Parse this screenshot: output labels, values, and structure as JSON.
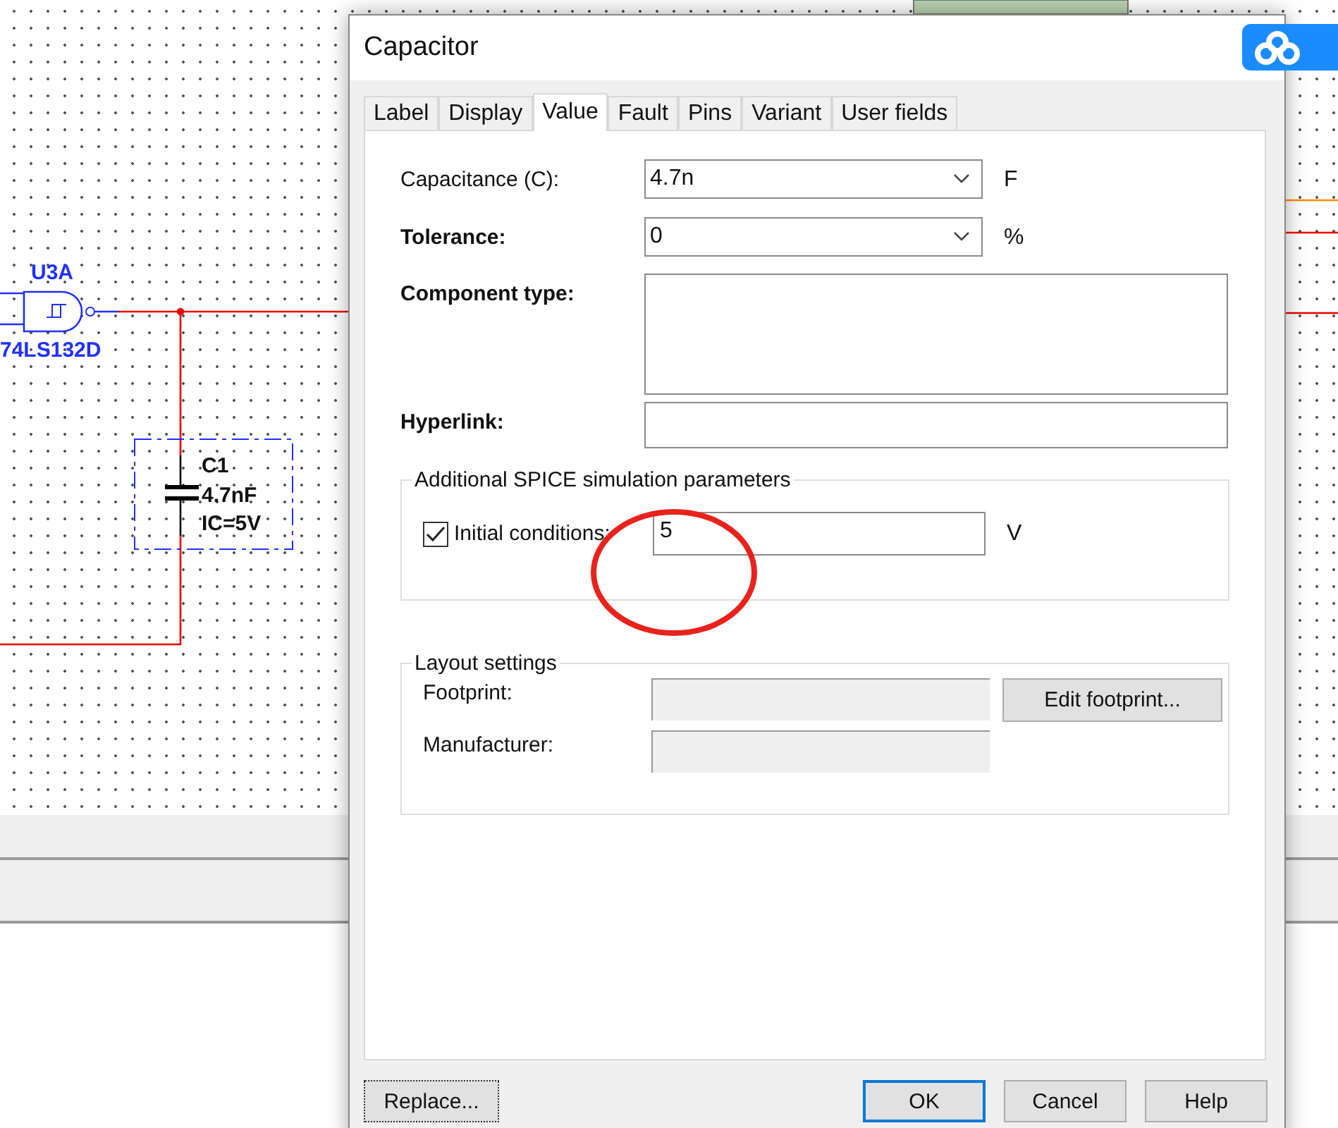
{
  "schematic": {
    "gate": {
      "ref": "U3A",
      "part": "74LS132D"
    },
    "capacitor": {
      "ref": "C1",
      "value": "4.7nF",
      "ic": "IC=5V"
    }
  },
  "dialog": {
    "title": "Capacitor",
    "tabs": [
      {
        "label": "Label",
        "selected": false
      },
      {
        "label": "Display",
        "selected": false
      },
      {
        "label": "Value",
        "selected": true
      },
      {
        "label": "Fault",
        "selected": false
      },
      {
        "label": "Pins",
        "selected": false
      },
      {
        "label": "Variant",
        "selected": false
      },
      {
        "label": "User fields",
        "selected": false
      }
    ],
    "fields": [
      {
        "kind": "combo",
        "label": "Capacitance (C):",
        "bold": false,
        "value": "4.7n",
        "unit": "F"
      },
      {
        "kind": "combo",
        "label": "Tolerance:",
        "bold": true,
        "value": "0",
        "unit": "%"
      },
      {
        "kind": "textarea",
        "label": "Component type:",
        "bold": true
      },
      {
        "kind": "text",
        "label": "Hyperlink:",
        "bold": true
      }
    ],
    "spice": {
      "title": "Additional SPICE simulation parameters",
      "label": "Initial conditions:",
      "checked": true,
      "value": "5",
      "unit": "V"
    },
    "layout": {
      "title": "Layout settings",
      "fields": [
        {
          "label": "Footprint:"
        },
        {
          "label": "Manufacturer:"
        }
      ],
      "button": "Edit footprint..."
    },
    "left_buttons": [
      {
        "label": "Replace...",
        "default": false
      }
    ],
    "right_buttons": [
      {
        "label": "OK",
        "default": true
      },
      {
        "label": "Cancel",
        "default": false
      },
      {
        "label": "Help",
        "default": false
      }
    ]
  }
}
